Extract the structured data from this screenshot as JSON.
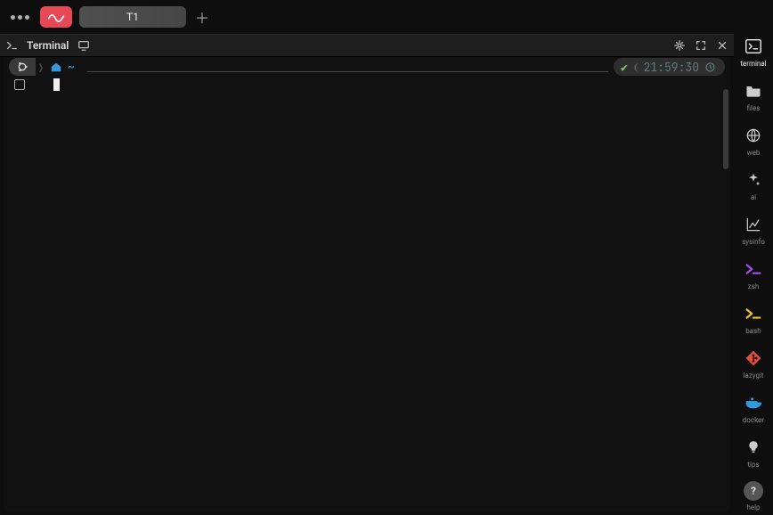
{
  "tabs": {
    "active_label": "T1"
  },
  "pane": {
    "title": "Terminal"
  },
  "prompt": {
    "path": "~",
    "time": "21:59:30"
  },
  "rail": {
    "items": [
      {
        "id": "terminal",
        "label": "terminal"
      },
      {
        "id": "files",
        "label": "files"
      },
      {
        "id": "web",
        "label": "web"
      },
      {
        "id": "ai",
        "label": "ai"
      },
      {
        "id": "sysinfo",
        "label": "sysinfo"
      },
      {
        "id": "zsh",
        "label": "zsh"
      },
      {
        "id": "bash",
        "label": "bash"
      },
      {
        "id": "lazygit",
        "label": "lazygit"
      },
      {
        "id": "docker",
        "label": "docker"
      },
      {
        "id": "tips",
        "label": "tips"
      },
      {
        "id": "help",
        "label": "help"
      }
    ]
  }
}
